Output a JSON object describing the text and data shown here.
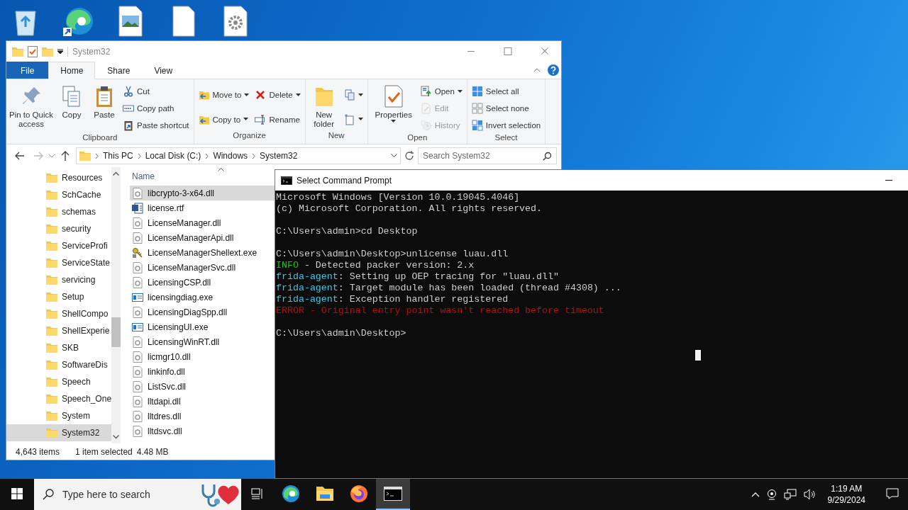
{
  "explorer": {
    "title": "System32",
    "tabs": [
      {
        "label": "File",
        "kind": "file",
        "selected": false
      },
      {
        "label": "Home",
        "kind": "tab",
        "selected": true
      },
      {
        "label": "Share",
        "kind": "tab",
        "selected": false
      },
      {
        "label": "View",
        "kind": "tab",
        "selected": false
      }
    ],
    "ribbon": [
      {
        "label": "Clipboard",
        "columns": [
          [
            {
              "kind": "large",
              "label": "Pin to Quick access",
              "caret": false,
              "disabled": false
            }
          ],
          [
            {
              "kind": "large",
              "label": "Copy",
              "caret": false,
              "disabled": false
            }
          ],
          [
            {
              "kind": "large",
              "label": "Paste",
              "caret": false,
              "disabled": false
            }
          ],
          [
            {
              "kind": "small",
              "label": "Cut",
              "caret": false,
              "disabled": false
            },
            {
              "kind": "small",
              "label": "Copy path",
              "caret": false,
              "disabled": false
            },
            {
              "kind": "small",
              "label": "Paste shortcut",
              "caret": false,
              "disabled": false
            }
          ]
        ]
      },
      {
        "label": "Organize",
        "columns": [
          [
            {
              "kind": "small",
              "label": "Move to",
              "caret": true,
              "disabled": false
            },
            {
              "kind": "small",
              "label": "Copy to",
              "caret": true,
              "disabled": false
            }
          ],
          [
            {
              "kind": "small",
              "label": "Delete",
              "caret": true,
              "disabled": false
            },
            {
              "kind": "small",
              "label": "Rename",
              "caret": false,
              "disabled": false
            }
          ]
        ]
      },
      {
        "label": "New",
        "columns": [
          [
            {
              "kind": "large",
              "label": "New folder",
              "caret": false,
              "disabled": false
            }
          ],
          [
            {
              "kind": "icon",
              "caret": true,
              "disabled": false
            },
            {
              "kind": "icon",
              "caret": true,
              "disabled": false
            }
          ]
        ]
      },
      {
        "label": "Open",
        "columns": [
          [
            {
              "kind": "large",
              "label": "Properties",
              "caret": true,
              "disabled": false
            }
          ],
          [
            {
              "kind": "small",
              "label": "Open",
              "caret": true,
              "disabled": false
            },
            {
              "kind": "small",
              "label": "Edit",
              "caret": false,
              "disabled": true
            },
            {
              "kind": "small",
              "label": "History",
              "caret": false,
              "disabled": true
            }
          ]
        ]
      },
      {
        "label": "Select",
        "columns": [
          [
            {
              "kind": "small",
              "label": "Select all",
              "caret": false,
              "disabled": false
            },
            {
              "kind": "small",
              "label": "Select none",
              "caret": false,
              "disabled": false
            },
            {
              "kind": "small",
              "label": "Invert selection",
              "caret": false,
              "disabled": false
            }
          ]
        ]
      }
    ],
    "address": {
      "forward_disabled": true,
      "path": [
        "This PC",
        "Local Disk (C:)",
        "Windows",
        "System32"
      ],
      "search": {
        "placeholder": "Search System32"
      }
    },
    "nav": [
      {
        "label": "Resources",
        "selected": false
      },
      {
        "label": "SchCache",
        "selected": false
      },
      {
        "label": "schemas",
        "selected": false
      },
      {
        "label": "security",
        "selected": false
      },
      {
        "label": "ServiceProfi",
        "selected": false
      },
      {
        "label": "ServiceState",
        "selected": false
      },
      {
        "label": "servicing",
        "selected": false
      },
      {
        "label": "Setup",
        "selected": false
      },
      {
        "label": "ShellCompo",
        "selected": false
      },
      {
        "label": "ShellExperie",
        "selected": false
      },
      {
        "label": "SKB",
        "selected": false
      },
      {
        "label": "SoftwareDis",
        "selected": false
      },
      {
        "label": "Speech",
        "selected": false
      },
      {
        "label": "Speech_One",
        "selected": false
      },
      {
        "label": "System",
        "selected": false
      },
      {
        "label": "System32",
        "selected": true
      }
    ],
    "column": "Name",
    "files": [
      {
        "name": "libcrypto-3-x64.dll",
        "kind": "dll",
        "selected": true
      },
      {
        "name": "license.rtf",
        "kind": "document",
        "selected": false
      },
      {
        "name": "LicenseManager.dll",
        "kind": "dll",
        "selected": false
      },
      {
        "name": "LicenseManagerApi.dll",
        "kind": "dll",
        "selected": false
      },
      {
        "name": "LicenseManagerShellext.exe",
        "kind": "keys",
        "selected": false
      },
      {
        "name": "LicenseManagerSvc.dll",
        "kind": "dll",
        "selected": false
      },
      {
        "name": "LicensingCSP.dll",
        "kind": "dll",
        "selected": false
      },
      {
        "name": "licensingdiag.exe",
        "kind": "app",
        "selected": false
      },
      {
        "name": "LicensingDiagSpp.dll",
        "kind": "dll",
        "selected": false
      },
      {
        "name": "LicensingUI.exe",
        "kind": "app",
        "selected": false
      },
      {
        "name": "LicensingWinRT.dll",
        "kind": "dll",
        "selected": false
      },
      {
        "name": "licmgr10.dll",
        "kind": "dll",
        "selected": false
      },
      {
        "name": "linkinfo.dll",
        "kind": "dll",
        "selected": false
      },
      {
        "name": "ListSvc.dll",
        "kind": "dll",
        "selected": false
      },
      {
        "name": "lltdapi.dll",
        "kind": "dll",
        "selected": false
      },
      {
        "name": "lltdres.dll",
        "kind": "dll",
        "selected": false
      },
      {
        "name": "lltdsvc.dll",
        "kind": "dll",
        "selected": false
      }
    ],
    "status": [
      "4,643 items",
      "1 item selected",
      "4.48 MB"
    ]
  },
  "console": {
    "title": "Select Command Prompt",
    "lines": [
      {
        "space_before": false,
        "segments": [
          {
            "text": "Microsoft Windows [Version 10.0.19045.4046]",
            "color": "#cccccc"
          }
        ]
      },
      {
        "space_before": false,
        "segments": [
          {
            "text": "(c) Microsoft Corporation. All rights reserved.",
            "color": "#cccccc"
          }
        ]
      },
      {
        "space_before": true,
        "segments": [
          {
            "text": "C:\\Users\\admin>cd Desktop",
            "color": "#cccccc"
          }
        ]
      },
      {
        "space_before": true,
        "segments": [
          {
            "text": "C:\\Users\\admin\\Desktop>unlicense luau.dll",
            "color": "#cccccc"
          }
        ]
      },
      {
        "space_before": false,
        "segments": [
          {
            "text": "INFO",
            "color": "#16c60c"
          },
          {
            "text": " - Detected packer version: 2.x",
            "color": "#cccccc"
          }
        ]
      },
      {
        "space_before": false,
        "segments": [
          {
            "text": "frida-agent",
            "color": "#3ac8e0"
          },
          {
            "text": ": Setting up OEP tracing for \"luau.dll\"",
            "color": "#cccccc"
          }
        ]
      },
      {
        "space_before": false,
        "segments": [
          {
            "text": "frida-agent",
            "color": "#3ac8e0"
          },
          {
            "text": ": Target module has been loaded (thread #4308) ...",
            "color": "#cccccc"
          }
        ]
      },
      {
        "space_before": false,
        "segments": [
          {
            "text": "frida-agent",
            "color": "#3ac8e0"
          },
          {
            "text": ": Exception handler registered",
            "color": "#cccccc"
          }
        ]
      },
      {
        "space_before": false,
        "segments": [
          {
            "text": "ERROR - Original entry point wasn't reached before timeout",
            "color": "#b01010"
          }
        ]
      },
      {
        "space_before": true,
        "segments": [
          {
            "text": "C:\\Users\\admin\\Desktop>",
            "color": "#cccccc"
          }
        ]
      }
    ]
  },
  "taskbar": {
    "search": {
      "placeholder": "Type here to search"
    },
    "apps": [
      {
        "kind": "browser",
        "selected": false
      },
      {
        "kind": "folder",
        "selected": false
      },
      {
        "kind": "firefox",
        "selected": false
      },
      {
        "kind": "console",
        "selected": true
      }
    ],
    "time": "1:19 AM",
    "date": "9/29/2024"
  }
}
